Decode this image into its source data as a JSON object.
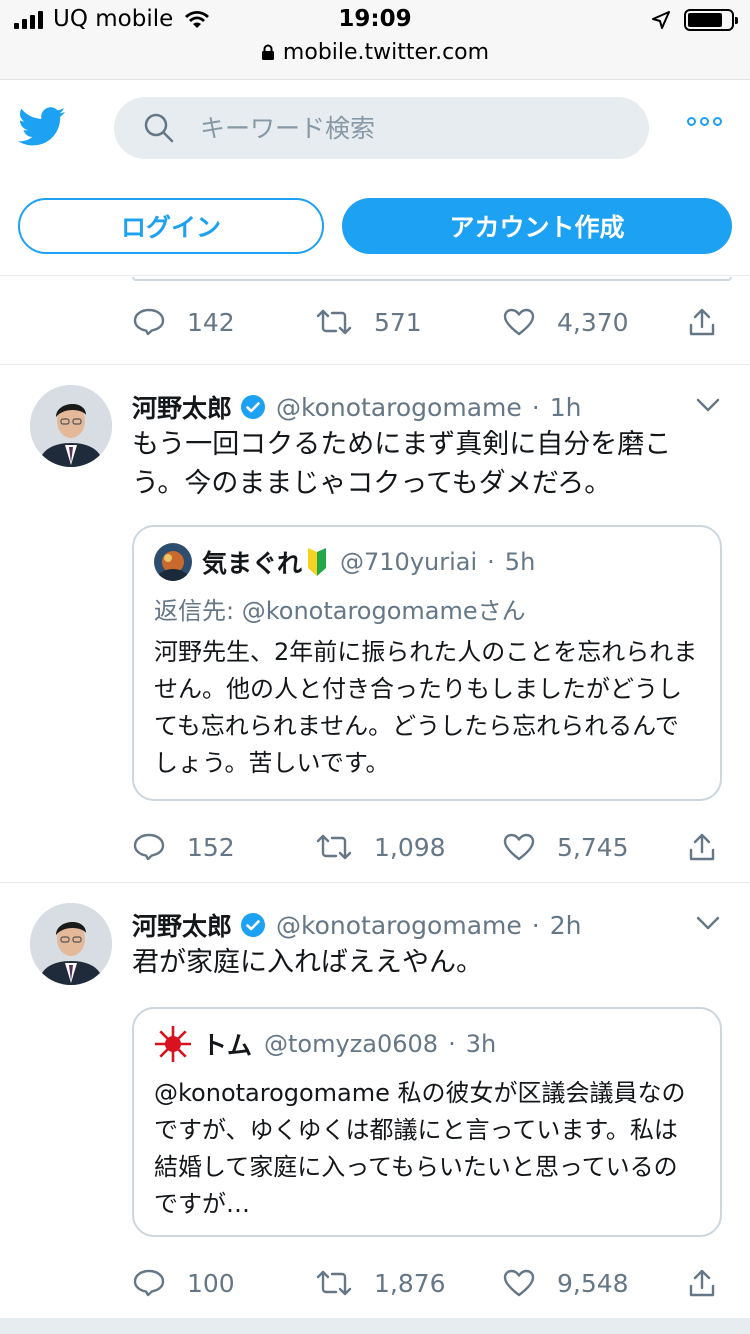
{
  "status": {
    "carrier": "UQ mobile",
    "time": "19:09",
    "url": "mobile.twitter.com",
    "battery_level": 0.8
  },
  "header": {
    "logo": "twitter-bird-icon",
    "search_placeholder": "キーワード検索",
    "login_label": "ログイン",
    "signup_label": "アカウント作成",
    "accent_color": "#1da1f2"
  },
  "tweets": [
    {
      "replies": "142",
      "retweets": "571",
      "likes": "4,370"
    },
    {
      "name": "河野太郎",
      "handle": "@konotarogomame",
      "time": "1h",
      "text": "もう一回コクるためにまず真剣に自分を磨こう。今のままじゃコクってもダメだろ。",
      "quote": {
        "name": "気まぐれ",
        "handle": "@710yuriai",
        "time": "5h",
        "reply_to": "返信先: @konotarogomameさん",
        "text": "河野先生、2年前に振られた人のことを忘れられません。他の人と付き合ったりもしましたがどうしても忘れられません。どうしたら忘れられるんでしょう。苦しいです。"
      },
      "replies": "152",
      "retweets": "1,098",
      "likes": "5,745"
    },
    {
      "name": "河野太郎",
      "handle": "@konotarogomame",
      "time": "2h",
      "text": "君が家庭に入ればええやん。",
      "quote": {
        "name": "トム",
        "handle": "@tomyza0608",
        "time": "3h",
        "text": "@konotarogomame 私の彼女が区議会議員なのですが、ゆくゆくは都議にと言っています。私は結婚して家庭に入ってもらいたいと思っているのですが…"
      },
      "replies": "100",
      "retweets": "1,876",
      "likes": "9,548"
    }
  ]
}
